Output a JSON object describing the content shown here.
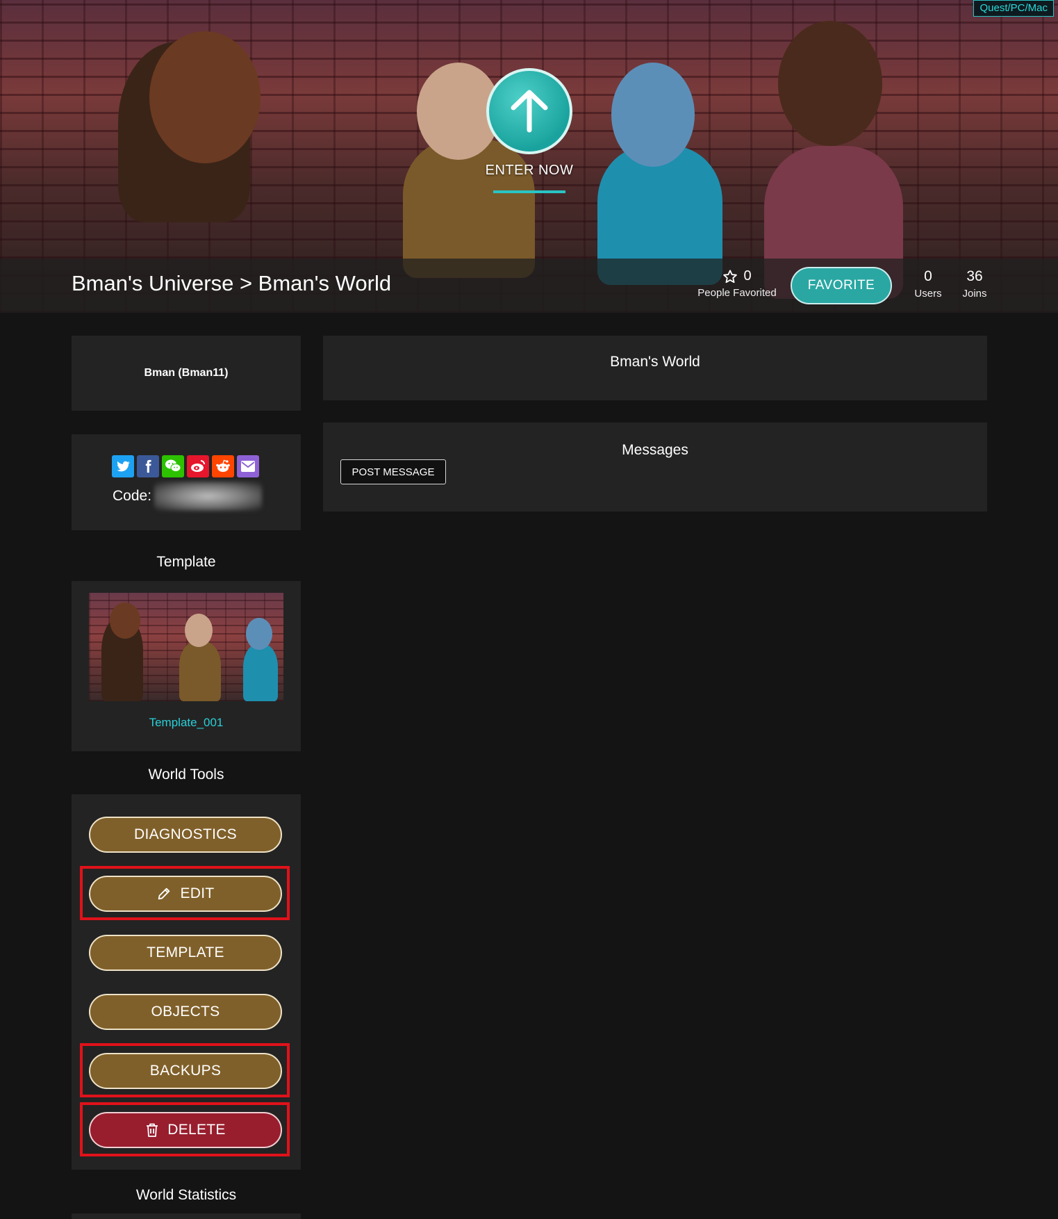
{
  "hero": {
    "platform_badge": "Quest/PC/Mac",
    "enter_label": "ENTER NOW",
    "breadcrumb": "Bman's Universe > Bman's World",
    "favorites": {
      "count": "0",
      "label": "People Favorited"
    },
    "favorite_button": "FAVORITE",
    "users": {
      "count": "0",
      "label": "Users"
    },
    "joins": {
      "count": "36",
      "label": "Joins"
    }
  },
  "sidebar": {
    "author": "Bman (Bman11)",
    "share": {
      "icons": [
        "twitter-icon",
        "facebook-icon",
        "wechat-icon",
        "weibo-icon",
        "reddit-icon",
        "email-icon"
      ],
      "code_label": "Code:"
    },
    "template": {
      "heading": "Template",
      "name": "Template_001"
    },
    "world_tools": {
      "heading": "World Tools",
      "buttons": {
        "diagnostics": "DIAGNOSTICS",
        "edit": "EDIT",
        "template": "TEMPLATE",
        "objects": "OBJECTS",
        "backups": "BACKUPS",
        "delete": "DELETE"
      }
    },
    "world_statistics": {
      "heading": "World Statistics"
    }
  },
  "main": {
    "world_name": "Bman's World",
    "messages": {
      "heading": "Messages",
      "post_button": "POST MESSAGE"
    }
  },
  "colors": {
    "accent_teal": "#2aa7a3",
    "tool_button": "#80602a",
    "delete_button": "#981e2e",
    "highlight_box": "#e0121a",
    "link": "#29d0d8"
  }
}
